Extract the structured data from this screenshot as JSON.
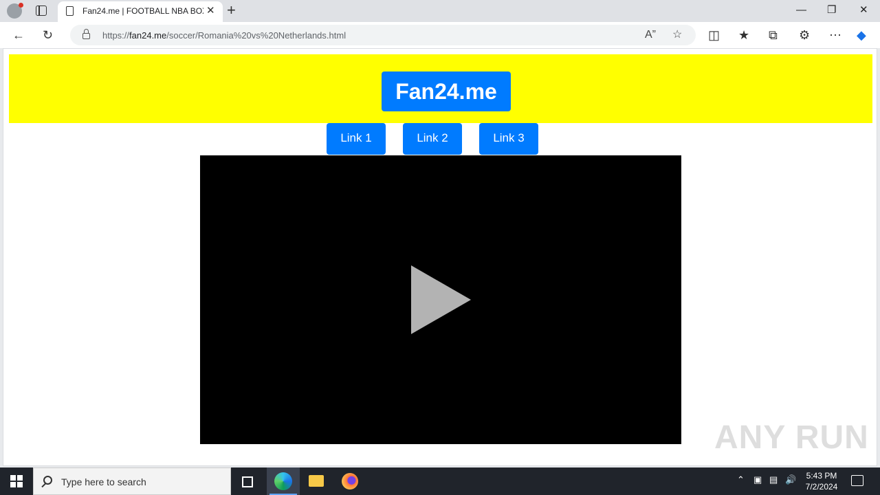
{
  "browser": {
    "tab_title": "Fan24.me | FOOTBALL NBA BOXI",
    "new_tab_symbol": "+",
    "close_symbol": "✕",
    "url_prefix": "https://",
    "url_host": "fan24.me",
    "url_path": "/soccer/Romania%20vs%20Netherlands.html"
  },
  "page": {
    "brand": "Fan24.me",
    "nav_links": [
      "Link 1",
      "Link 2",
      "Link 3"
    ],
    "watermark": "ANY RUN"
  },
  "taskbar": {
    "search_placeholder": "Type here to search",
    "time": "5:43 PM",
    "date": "7/2/2024"
  }
}
